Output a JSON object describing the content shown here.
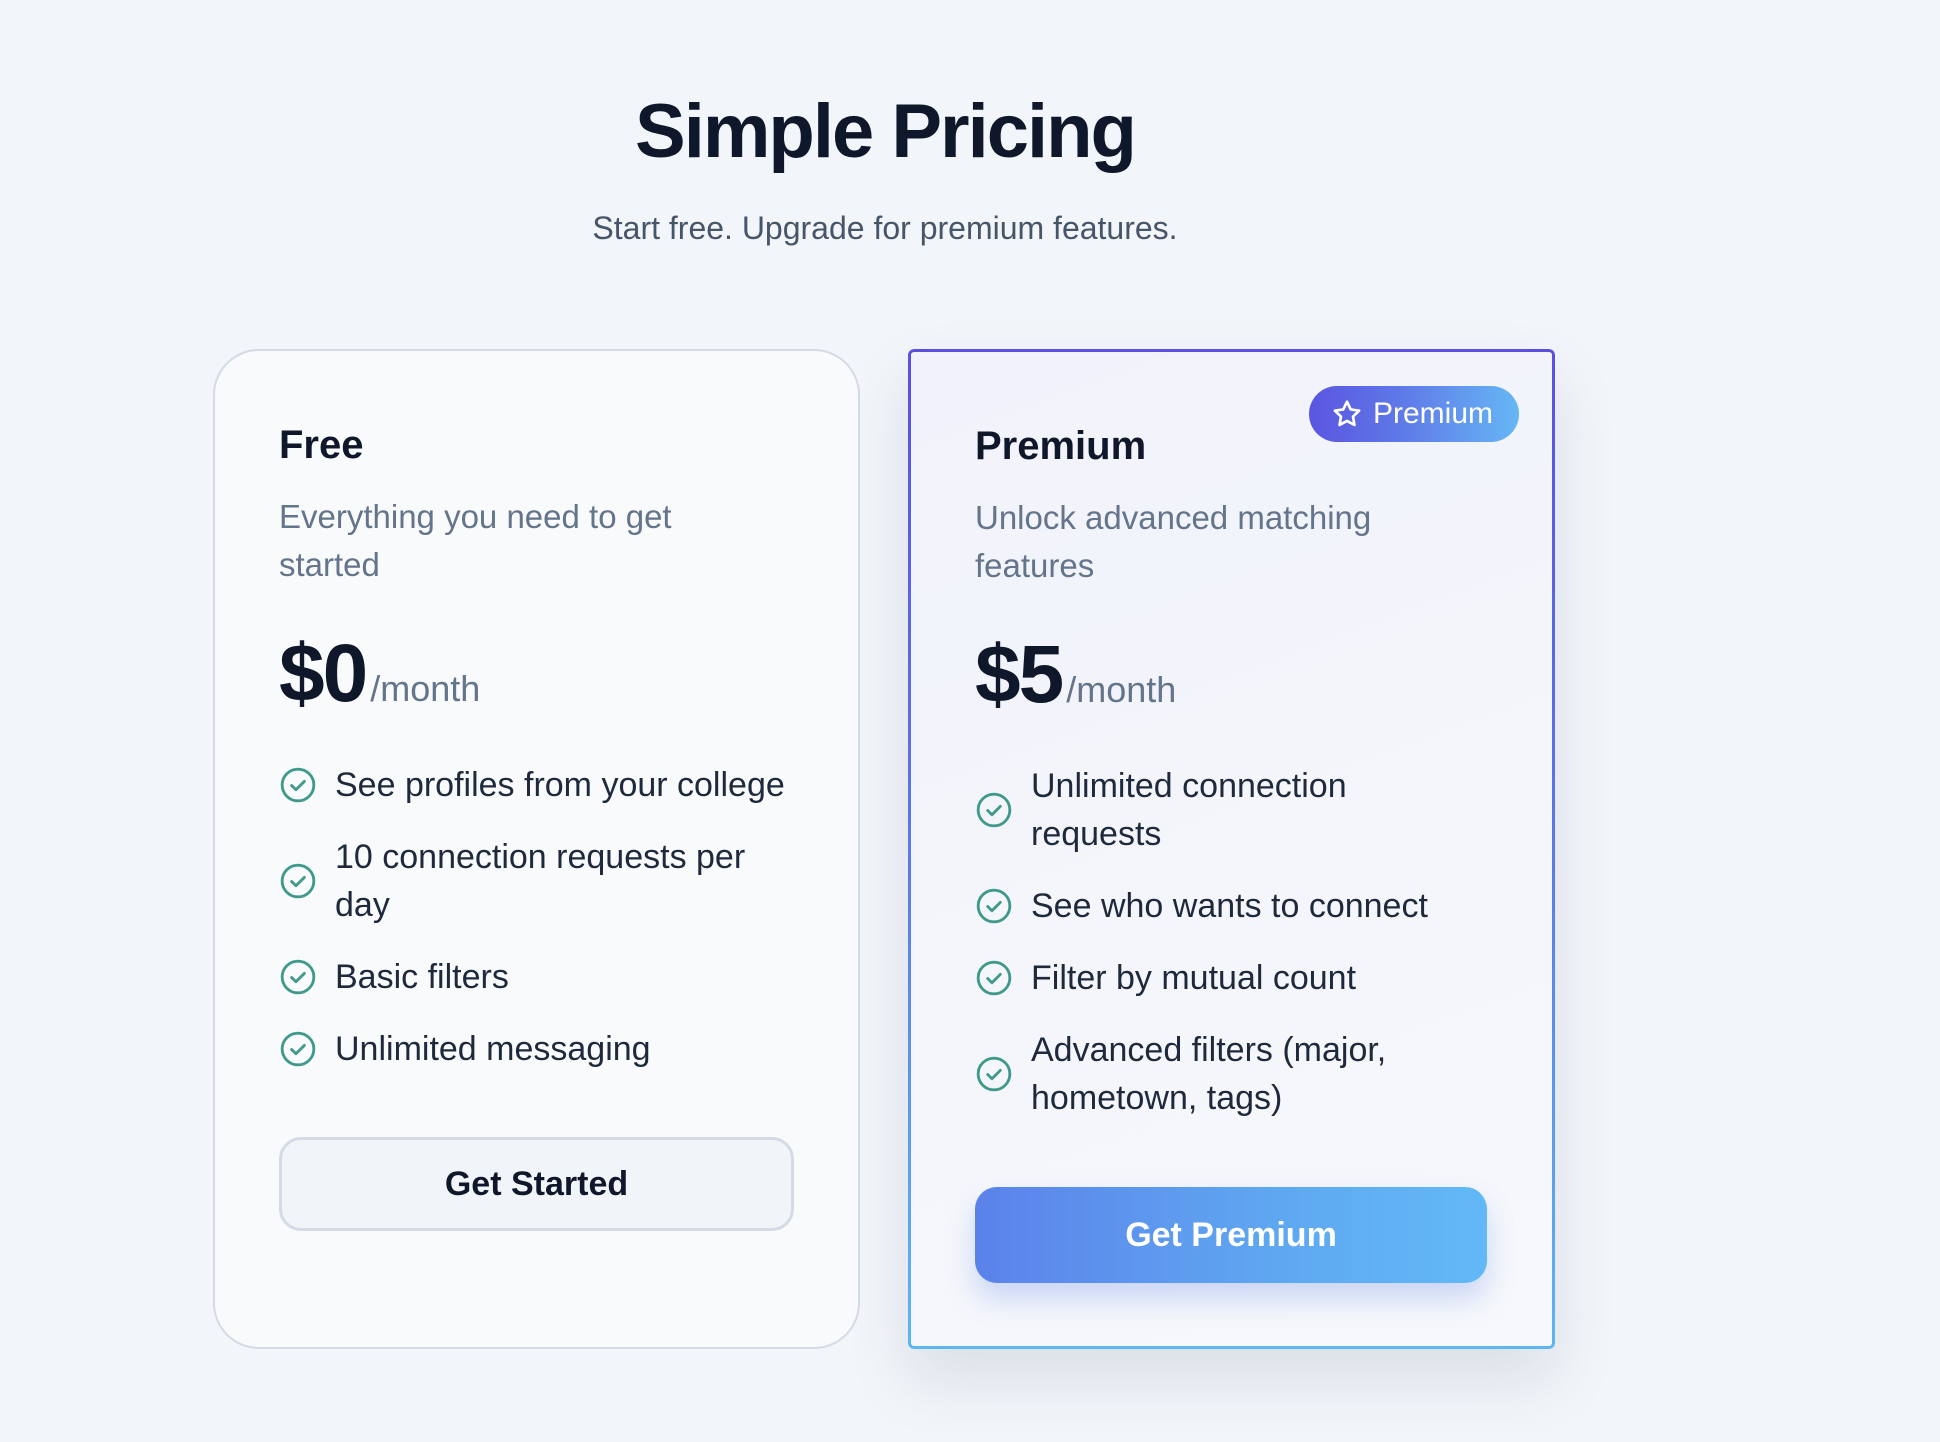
{
  "header": {
    "title": "Simple Pricing",
    "subtitle": "Start free. Upgrade for premium features."
  },
  "plans": [
    {
      "name": "Free",
      "description": "Everything you need to get started",
      "price": "$0",
      "period": "/month",
      "features": [
        "See profiles from your college",
        "10 connection requests per day",
        "Basic filters",
        "Unlimited messaging"
      ],
      "cta": "Get Started"
    },
    {
      "name": "Premium",
      "badge": "Premium",
      "badge_icon": "star-icon",
      "description": "Unlock advanced matching features",
      "price": "$5",
      "period": "/month",
      "features": [
        "Unlimited connection requests",
        "See who wants to connect",
        "Filter by mutual count",
        "Advanced filters (major, hometown, tags)"
      ],
      "cta": "Get Premium"
    }
  ],
  "colors": {
    "check": "#3f9a8c",
    "accent_start": "#5a55e0",
    "accent_end": "#62b9f6",
    "background": "#f2f5f9"
  },
  "icons": {
    "feature": "check-circle-icon"
  }
}
